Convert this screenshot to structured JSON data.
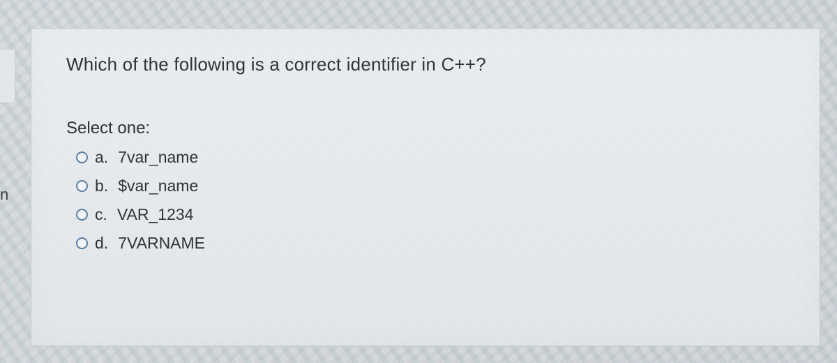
{
  "sidebar": {
    "cut_letter": "n"
  },
  "question": {
    "text": "Which of the following is a correct identifier in C++?",
    "select_label": "Select one:",
    "options": [
      {
        "letter": "a.",
        "text": "7var_name"
      },
      {
        "letter": "b.",
        "text": "$var_name"
      },
      {
        "letter": "c.",
        "text": "VAR_1234"
      },
      {
        "letter": "d.",
        "text": "7VARNAME"
      }
    ]
  }
}
